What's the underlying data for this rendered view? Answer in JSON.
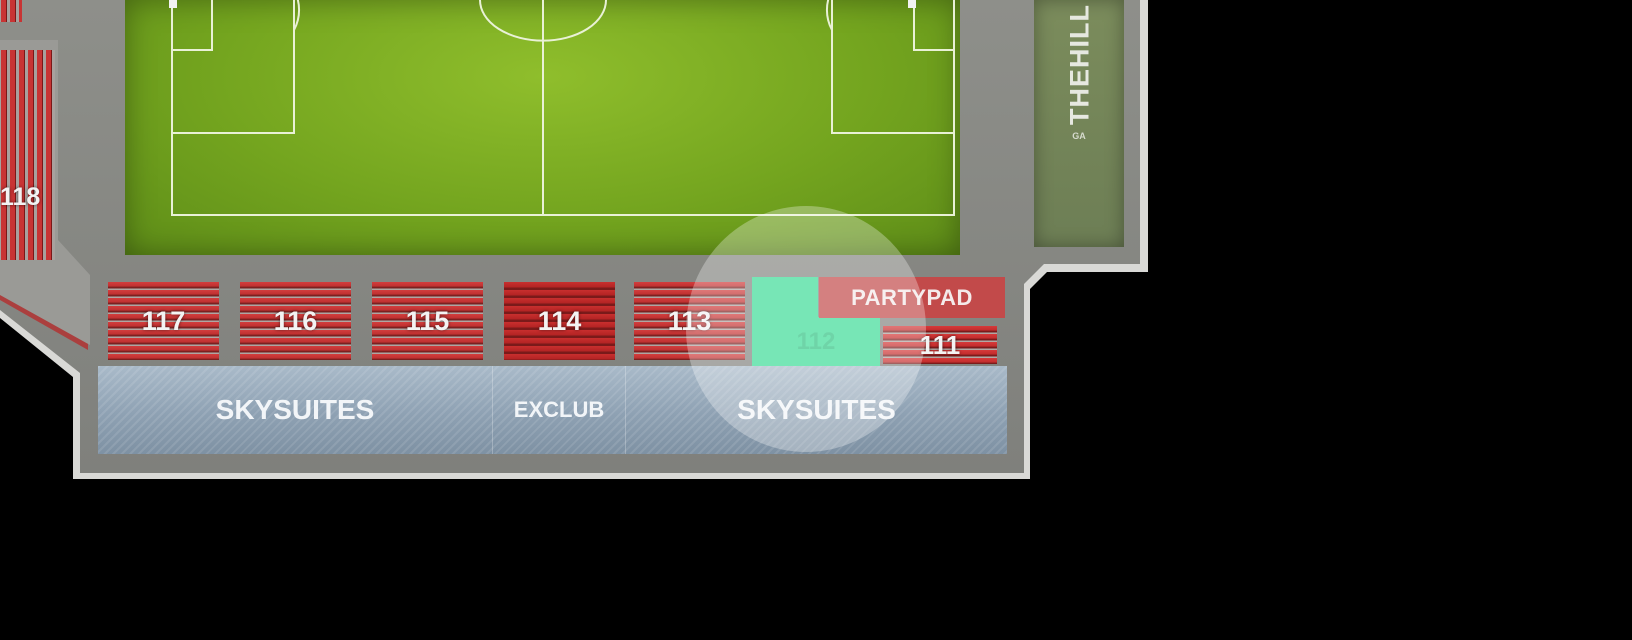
{
  "map": {
    "sections": [
      {
        "id": "117",
        "label": "117"
      },
      {
        "id": "116",
        "label": "116"
      },
      {
        "id": "115",
        "label": "115"
      },
      {
        "id": "114",
        "label": "114"
      },
      {
        "id": "113",
        "label": "113"
      }
    ],
    "section_112": "112",
    "section_111": "111",
    "section_118": "118",
    "partypad": "PARTYPAD",
    "suites": {
      "left": "SKYSUITES",
      "middle": "EXCLUB",
      "right": "SKYSUITES"
    },
    "hill": {
      "title": "THEHILL",
      "sub": "GA"
    }
  },
  "colors": {
    "pitch": "#74a51f",
    "seat_red": "#c42d2d",
    "selected_section": "#3ddc97",
    "partypad": "#c24a4a",
    "suites": "#8ea1b3",
    "concourse": "#8a8a87",
    "background": "#000000"
  }
}
